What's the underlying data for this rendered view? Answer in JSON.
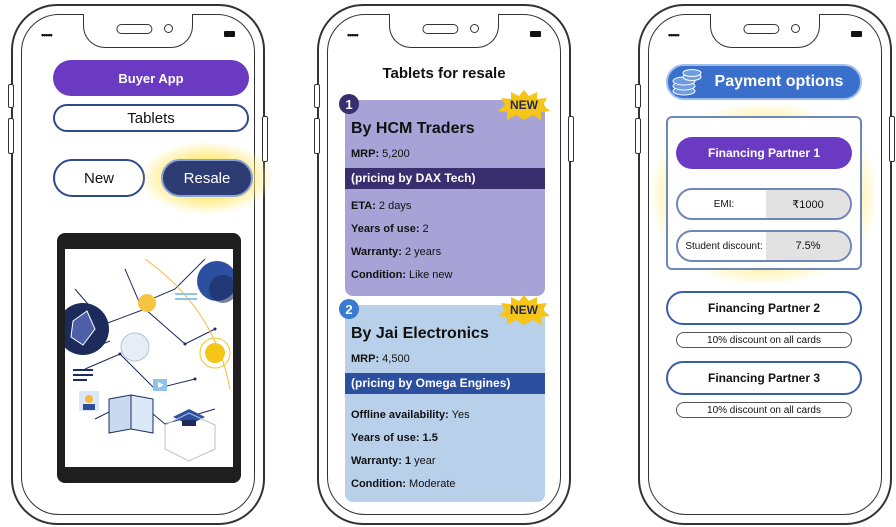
{
  "phone1": {
    "signal": "•••••",
    "app_title": "Buyer App",
    "category": "Tablets",
    "new_label": "New",
    "resale_label": "Resale"
  },
  "phone2": {
    "signal": "•••••",
    "title": "Tablets for resale",
    "listings": [
      {
        "number": "1",
        "badge": "NEW",
        "seller": "By HCM Traders",
        "mrp_label": "MRP:",
        "mrp_value": "5,200",
        "pricing": "(pricing by DAX Tech)",
        "details": [
          {
            "label": "ETA:",
            "value": "2 days"
          },
          {
            "label": "Years of use:",
            "value": "2"
          },
          {
            "label": "Warranty:",
            "value": "2 years"
          },
          {
            "label": "Condition:",
            "value": "Like new"
          }
        ]
      },
      {
        "number": "2",
        "badge": "NEW",
        "seller": "By Jai Electronics",
        "mrp_label": "MRP:",
        "mrp_value": "4,500",
        "pricing": "(pricing by Omega Engines)",
        "details": [
          {
            "label": "Offline availability:",
            "value": "Yes"
          },
          {
            "label": "Years of use: 1.5",
            "value": ""
          },
          {
            "label": "Warranty: 1",
            "value": "year"
          },
          {
            "label": "Condition:",
            "value": "Moderate"
          }
        ]
      }
    ]
  },
  "phone3": {
    "signal": "•••••",
    "header": "Payment options",
    "partner1": {
      "name": "Financing Partner 1",
      "emi_label": "EMI:",
      "emi_value": "₹1000",
      "discount_label": "Student discount:",
      "discount_value": "7.5%"
    },
    "partner2": {
      "name": "Financing Partner 2",
      "offer": "10% discount on all cards"
    },
    "partner3": {
      "name": "Financing Partner 3",
      "offer": "10% discount on all cards"
    }
  },
  "colors": {
    "accent_purple": "#6a3bc2",
    "navy": "#2d3d73",
    "highlight_glow": "#ffeb78",
    "card1_bg": "#a7a3d6",
    "card2_bg": "#b9d0ea",
    "badge_gold": "#f5c518"
  },
  "icons": [
    "coins-stack-icon",
    "battery-icon",
    "signal-icon",
    "starburst-badge-icon"
  ]
}
